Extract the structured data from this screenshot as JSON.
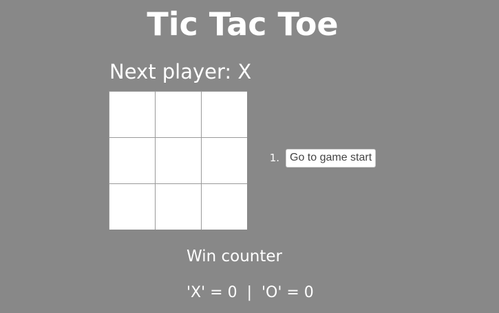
{
  "game": {
    "title": "Tic Tac Toe",
    "status": "Next player: X",
    "board": [
      "",
      "",
      "",
      "",
      "",
      "",
      "",
      "",
      ""
    ],
    "moves": [
      {
        "number": "1.",
        "label": "Go to game start"
      }
    ]
  },
  "counter": {
    "title": "Win counter",
    "scores": "'X' = 0  |  'O' = 0"
  },
  "colors": {
    "background": "#888888",
    "text": "#ffffff",
    "square": "#ffffff",
    "grid_line": "#999999"
  }
}
